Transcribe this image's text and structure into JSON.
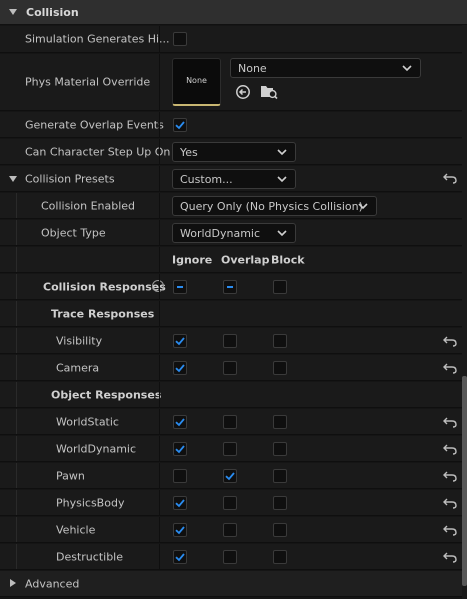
{
  "section": {
    "title": "Collision"
  },
  "properties": {
    "sim_hit": {
      "label": "Simulation Generates Hi..."
    },
    "phys_material": {
      "label": "Phys Material Override",
      "thumb": "None",
      "value": "None"
    },
    "gen_overlap": {
      "label": "Generate Overlap Events"
    },
    "step_up": {
      "label": "Can Character Step Up On",
      "value": "Yes"
    },
    "presets": {
      "label": "Collision Presets",
      "value": "Custom..."
    },
    "enabled": {
      "label": "Collision Enabled",
      "value": "Query Only (No Physics Collision)"
    },
    "object_type": {
      "label": "Object Type",
      "value": "WorldDynamic"
    }
  },
  "columns": {
    "ignore": "Ignore",
    "overlap": "Overlap",
    "block": "Block"
  },
  "responses": {
    "label": "Collision Responses",
    "trace_header": "Trace Responses",
    "object_header": "Object Responses",
    "trace": [
      {
        "name": "Visibility",
        "ignore": true,
        "overlap": false,
        "block": false
      },
      {
        "name": "Camera",
        "ignore": true,
        "overlap": false,
        "block": false
      }
    ],
    "object": [
      {
        "name": "WorldStatic",
        "ignore": true,
        "overlap": false,
        "block": false
      },
      {
        "name": "WorldDynamic",
        "ignore": true,
        "overlap": false,
        "block": false
      },
      {
        "name": "Pawn",
        "ignore": false,
        "overlap": true,
        "block": false
      },
      {
        "name": "PhysicsBody",
        "ignore": true,
        "overlap": false,
        "block": false
      },
      {
        "name": "Vehicle",
        "ignore": true,
        "overlap": false,
        "block": false
      },
      {
        "name": "Destructible",
        "ignore": true,
        "overlap": false,
        "block": false
      }
    ]
  },
  "advanced": {
    "label": "Advanced"
  },
  "colors": {
    "accent": "#2a8cf0",
    "material_underline": "#c9b772"
  },
  "icons": [
    "chevron-down-icon",
    "checkmark-icon",
    "reset-arrow-icon",
    "use-selected-icon",
    "browse-folder-icon"
  ]
}
